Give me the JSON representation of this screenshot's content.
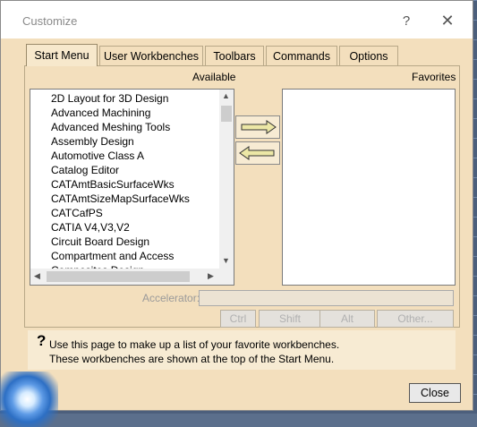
{
  "window": {
    "title": "Customize",
    "help_glyph": "?",
    "close_glyph": "✕"
  },
  "tabs": [
    {
      "label": "Start Menu",
      "active": true
    },
    {
      "label": "User Workbenches"
    },
    {
      "label": "Toolbars"
    },
    {
      "label": "Commands"
    },
    {
      "label": "Options"
    }
  ],
  "available": {
    "label": "Available",
    "items": [
      "2D Layout for 3D Design",
      "Advanced Machining",
      "Advanced Meshing Tools",
      "Assembly Design",
      "Automotive Class A",
      "Catalog Editor",
      "CATAmtBasicSurfaceWks",
      "CATAmtSizeMapSurfaceWks",
      "CATCafPS",
      "CATIA V4,V3,V2",
      "Circuit Board Design",
      "Compartment and Access",
      "Composites Design"
    ]
  },
  "favorites": {
    "label": "Favorites",
    "items": []
  },
  "accelerator": {
    "label": "Accelerator:",
    "value": ""
  },
  "keys": [
    "Ctrl",
    "Shift",
    "Alt",
    "Other..."
  ],
  "help": {
    "line1": "Use this page to make up a list of your favorite workbenches.",
    "line2": "These workbenches are shown at the top of the Start Menu."
  },
  "close_label": "Close",
  "colors": {
    "dialog_bg": "#f3dfbd",
    "arrow_fill": "#ece7a6"
  }
}
